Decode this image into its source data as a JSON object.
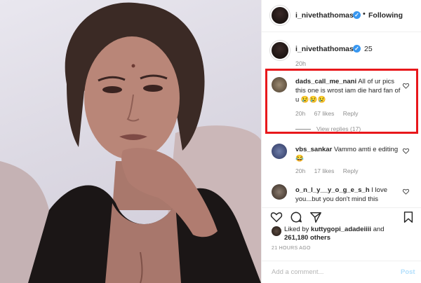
{
  "post": {
    "username": "i_nivethathomas",
    "following_label": "Following",
    "dot": "•",
    "verified_mark": "✓"
  },
  "caption": {
    "username": "i_nivethathomas",
    "text": "25",
    "time": "20h"
  },
  "comments": [
    {
      "username": "dads_call_me_nani",
      "text": "All of ur pics this one is wrost iam die hard fan of u 😢😢😢",
      "time": "20h",
      "likes": "67 likes",
      "reply": "Reply",
      "view_replies": "View replies (17)"
    },
    {
      "username": "vbs_sankar",
      "text": "Vammo amti e editing 😂",
      "time": "20h",
      "likes": "17 likes",
      "reply": "Reply"
    },
    {
      "username": "o_n_l_y__y_o_g_e_s_h",
      "text": "I love you...but you don't mind this"
    }
  ],
  "liked_by": {
    "prefix": "Liked by",
    "user": "kuttygopi_adadeiiii",
    "suffix": "and",
    "others": "261,180 others"
  },
  "time_ago": "21 HOURS AGO",
  "add_comment": {
    "placeholder": "Add a comment...",
    "post_label": "Post"
  },
  "icons": {
    "like": "heart-icon",
    "comment": "comment-icon",
    "share": "share-icon",
    "save": "bookmark-icon"
  },
  "colors": {
    "highlight": "#e8181c",
    "verified": "#3897f0",
    "muted": "#8e8e8e"
  }
}
